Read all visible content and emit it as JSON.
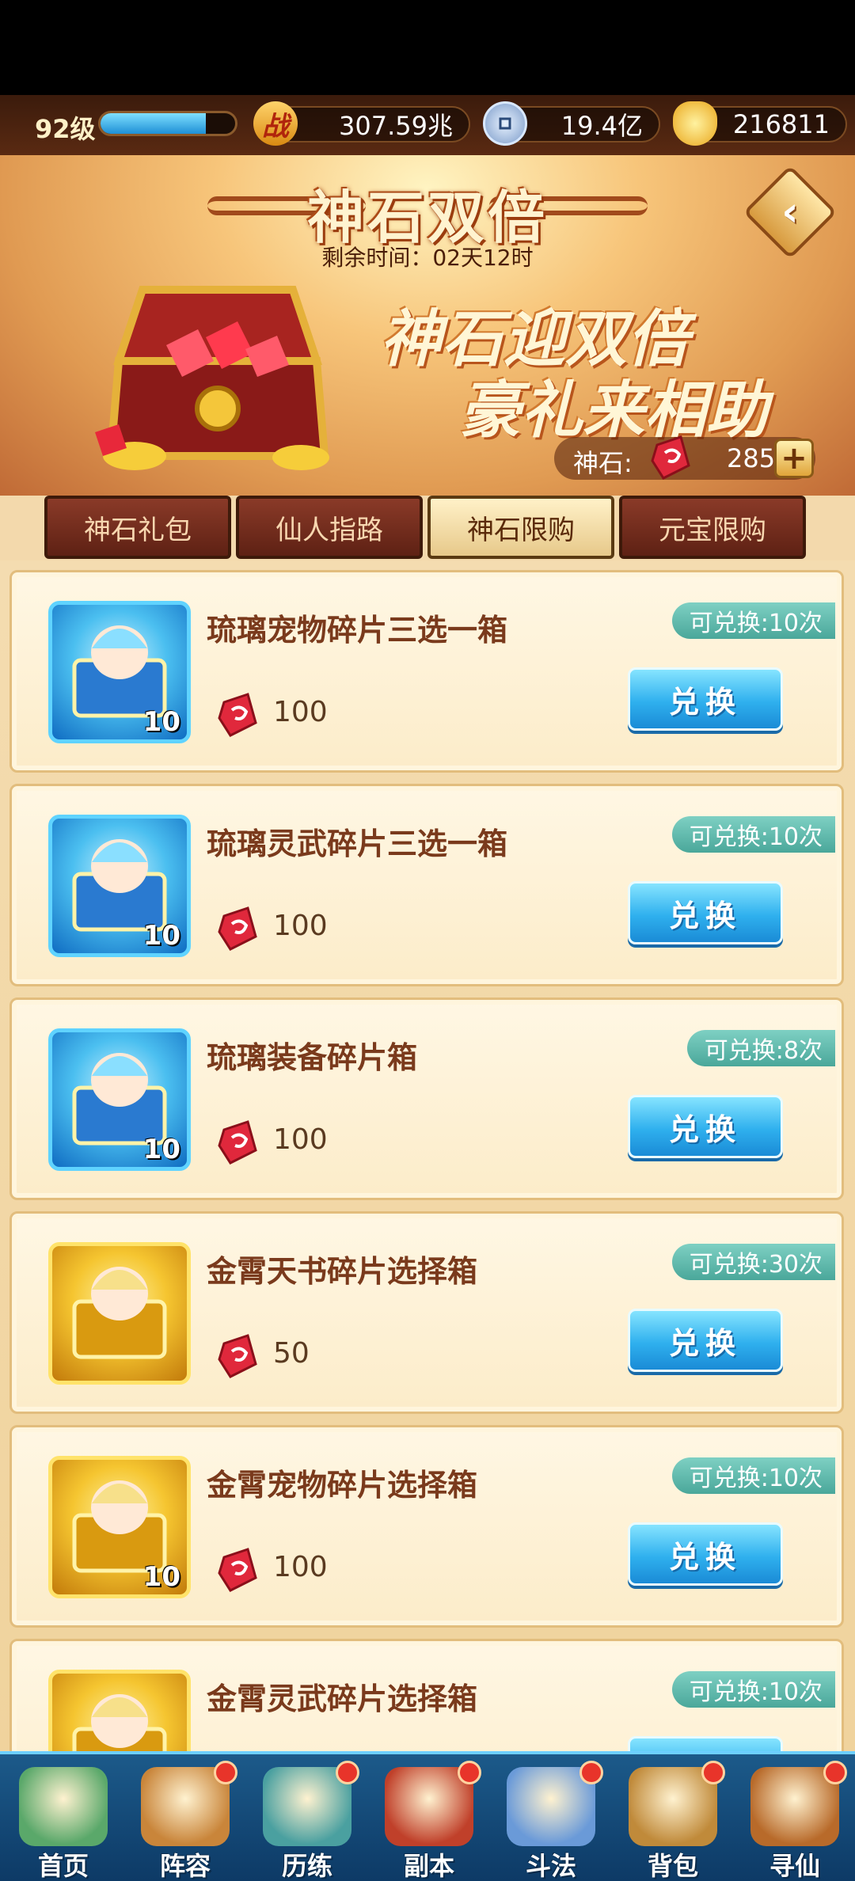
{
  "top_bar": {
    "level": "92级",
    "exp_fraction": 0.78,
    "combat_value": "307.59兆",
    "combat_icon_text": "战",
    "coin_value": "19.4亿",
    "ingot_value": "216811"
  },
  "banner": {
    "title": "神石双倍",
    "countdown": "剩余时间：02天12时",
    "slogan_line1": "神石迎双倍",
    "slogan_line2": "豪礼来相助",
    "stone_label": "神石:",
    "stone_value": "2852",
    "plus_label": "+"
  },
  "tabs": [
    {
      "label": "神石礼包",
      "active": false
    },
    {
      "label": "仙人指路",
      "active": false
    },
    {
      "label": "神石限购",
      "active": true
    },
    {
      "label": "元宝限购",
      "active": false
    }
  ],
  "exchange_label": "兑换",
  "items": [
    {
      "name": "琉璃宠物碎片三选一箱",
      "cost": "100",
      "limit": "可兑换:10次",
      "qty": "10",
      "icon": "blue-pet-chest-icon",
      "style": "blue"
    },
    {
      "name": "琉璃灵武碎片三选一箱",
      "cost": "100",
      "limit": "可兑换:10次",
      "qty": "10",
      "icon": "blue-weapon-chest-icon",
      "style": "blue"
    },
    {
      "name": "琉璃装备碎片箱",
      "cost": "100",
      "limit": "可兑换:8次",
      "qty": "10",
      "icon": "blue-equipment-chest-icon",
      "style": "blue"
    },
    {
      "name": "金霄天书碎片选择箱",
      "cost": "50",
      "limit": "可兑换:30次",
      "qty": "",
      "icon": "gold-book-bag-icon",
      "style": "gold"
    },
    {
      "name": "金霄宠物碎片选择箱",
      "cost": "100",
      "limit": "可兑换:10次",
      "qty": "10",
      "icon": "gold-pet-chest-icon",
      "style": "gold"
    },
    {
      "name": "金霄灵武碎片选择箱",
      "cost": "",
      "limit": "可兑换:10次",
      "qty": "",
      "icon": "gold-weapon-chest-icon",
      "style": "gold"
    }
  ],
  "bottom_nav": [
    {
      "label": "首页",
      "icon": "home-icon",
      "dot": false
    },
    {
      "label": "阵容",
      "icon": "lineup-icon",
      "dot": true
    },
    {
      "label": "历练",
      "icon": "training-icon",
      "dot": true
    },
    {
      "label": "副本",
      "icon": "dungeon-icon",
      "dot": true
    },
    {
      "label": "斗法",
      "icon": "battle-icon",
      "dot": true
    },
    {
      "label": "背包",
      "icon": "backpack-icon",
      "dot": true
    },
    {
      "label": "寻仙",
      "icon": "seek-immortal-icon",
      "dot": true
    }
  ],
  "colors": {
    "accent_blue": "#2fb0ee",
    "gem_red": "#d82a3a",
    "badge_teal": "#4aa79a"
  }
}
